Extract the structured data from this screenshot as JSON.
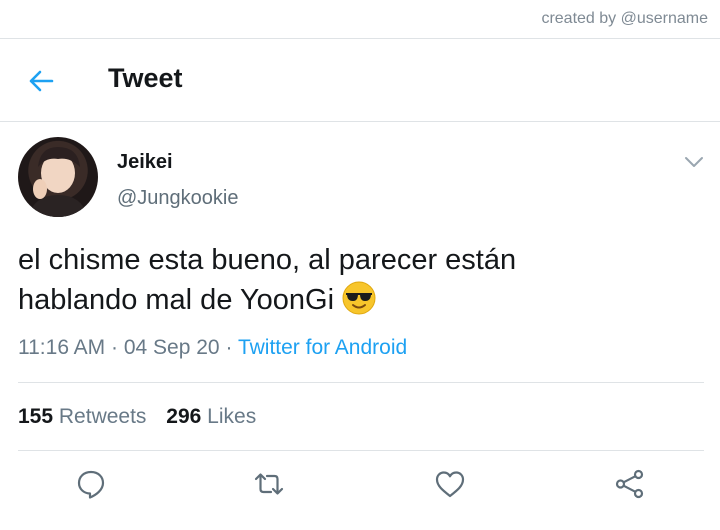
{
  "credit": "created by @username",
  "header": {
    "title": "Tweet"
  },
  "tweet": {
    "author_name": "Jeikei",
    "author_handle": "@Jungkookie",
    "text_line1": "el chisme esta bueno, al parecer están",
    "text_line2": "hablando mal de YoonGi",
    "emoji": "smiling-face-with-sunglasses",
    "time": "11:16 AM",
    "date": "04 Sep 20",
    "source": "Twitter for Android"
  },
  "stats": {
    "retweets_count": "155",
    "retweets_label": "Retweets",
    "likes_count": "296",
    "likes_label": "Likes"
  },
  "actions": [
    "reply-icon",
    "retweet-icon",
    "like-icon",
    "share-icon"
  ],
  "colors": {
    "accent": "#1da1f2",
    "text_primary": "#14171a",
    "text_secondary": "#687987",
    "divider": "#dfe3e6"
  }
}
